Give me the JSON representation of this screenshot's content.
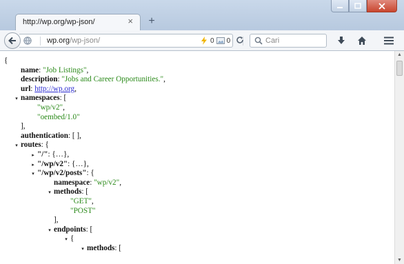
{
  "tab": {
    "title": "http://wp.org/wp-json/",
    "close": "×",
    "new_tab": "+"
  },
  "window": {
    "minimize": "—",
    "maximize": "□",
    "close": "✕"
  },
  "urlbar": {
    "host": "wp.org",
    "path": "/wp-json/"
  },
  "addon": {
    "left_count": "0",
    "right_count": "0"
  },
  "search": {
    "placeholder": "Cari"
  },
  "json_lines": [
    {
      "indent": 0,
      "twisty": "",
      "parts": [
        [
          "p",
          "{"
        ]
      ]
    },
    {
      "indent": 1,
      "twisty": "",
      "parts": [
        [
          "k",
          "name"
        ],
        [
          "p",
          ": "
        ],
        [
          "s",
          "\"Job Listings\""
        ],
        [
          "p",
          ","
        ]
      ]
    },
    {
      "indent": 1,
      "twisty": "",
      "parts": [
        [
          "k",
          "description"
        ],
        [
          "p",
          ": "
        ],
        [
          "s",
          "\"Jobs and Career Opportunities.\""
        ],
        [
          "p",
          ","
        ]
      ]
    },
    {
      "indent": 1,
      "twisty": "",
      "parts": [
        [
          "k",
          "url"
        ],
        [
          "p",
          ": "
        ],
        [
          "l",
          "http://wp.org"
        ],
        [
          "p",
          ","
        ]
      ]
    },
    {
      "indent": 1,
      "twisty": "▾",
      "parts": [
        [
          "k",
          "namespaces"
        ],
        [
          "p",
          ": ["
        ]
      ]
    },
    {
      "indent": 2,
      "twisty": "",
      "parts": [
        [
          "s",
          "\"wp/v2\""
        ],
        [
          "p",
          ","
        ]
      ]
    },
    {
      "indent": 2,
      "twisty": "",
      "parts": [
        [
          "s",
          "\"oembed/1.0\""
        ]
      ]
    },
    {
      "indent": 1,
      "twisty": "",
      "parts": [
        [
          "p",
          "],"
        ]
      ]
    },
    {
      "indent": 1,
      "twisty": "",
      "parts": [
        [
          "k",
          "authentication"
        ],
        [
          "p",
          ": [ ],"
        ]
      ]
    },
    {
      "indent": 1,
      "twisty": "▾",
      "parts": [
        [
          "k",
          "routes"
        ],
        [
          "p",
          ": {"
        ]
      ]
    },
    {
      "indent": 2,
      "twisty": "▸",
      "parts": [
        [
          "k",
          "\"/\""
        ],
        [
          "p",
          ": {…},"
        ]
      ]
    },
    {
      "indent": 2,
      "twisty": "▸",
      "parts": [
        [
          "k",
          "\"/wp/v2\""
        ],
        [
          "p",
          ": {…},"
        ]
      ]
    },
    {
      "indent": 2,
      "twisty": "▾",
      "parts": [
        [
          "k",
          "\"/wp/v2/posts\""
        ],
        [
          "p",
          ": {"
        ]
      ]
    },
    {
      "indent": 3,
      "twisty": "",
      "parts": [
        [
          "k",
          "namespace"
        ],
        [
          "p",
          ": "
        ],
        [
          "s",
          "\"wp/v2\""
        ],
        [
          "p",
          ","
        ]
      ]
    },
    {
      "indent": 3,
      "twisty": "▾",
      "parts": [
        [
          "k",
          "methods"
        ],
        [
          "p",
          ": ["
        ]
      ]
    },
    {
      "indent": 4,
      "twisty": "",
      "parts": [
        [
          "s",
          "\"GET\""
        ],
        [
          "p",
          ","
        ]
      ]
    },
    {
      "indent": 4,
      "twisty": "",
      "parts": [
        [
          "s",
          "\"POST\""
        ]
      ]
    },
    {
      "indent": 3,
      "twisty": "",
      "parts": [
        [
          "p",
          "],"
        ]
      ]
    },
    {
      "indent": 3,
      "twisty": "▾",
      "parts": [
        [
          "k",
          "endpoints"
        ],
        [
          "p",
          ": ["
        ]
      ]
    },
    {
      "indent": 4,
      "twisty": "▾",
      "parts": [
        [
          "p",
          "{"
        ]
      ]
    },
    {
      "indent": 5,
      "twisty": "▾",
      "parts": [
        [
          "k",
          "methods"
        ],
        [
          "p",
          ": ["
        ]
      ]
    }
  ]
}
